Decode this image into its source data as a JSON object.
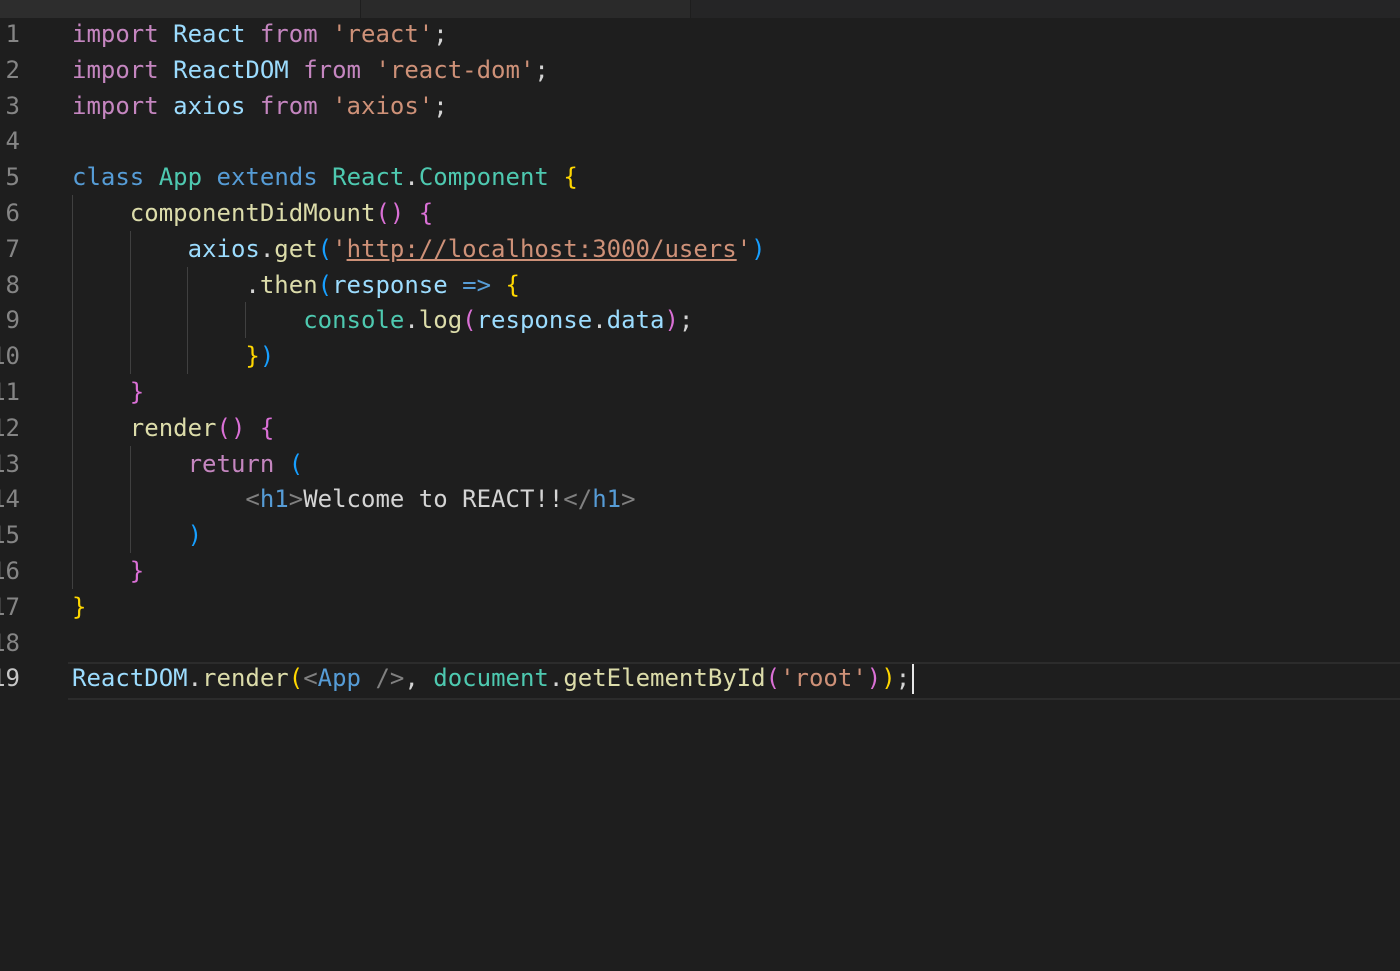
{
  "editor": {
    "active_line": 19,
    "lines": [
      {
        "number": "1",
        "tokens": [
          {
            "t": "import",
            "c": "kw"
          },
          {
            "t": " ",
            "c": "p"
          },
          {
            "t": "React",
            "c": "var"
          },
          {
            "t": " ",
            "c": "p"
          },
          {
            "t": "from",
            "c": "kw"
          },
          {
            "t": " ",
            "c": "p"
          },
          {
            "t": "'react'",
            "c": "str"
          },
          {
            "t": ";",
            "c": "p"
          }
        ]
      },
      {
        "number": "2",
        "tokens": [
          {
            "t": "import",
            "c": "kw"
          },
          {
            "t": " ",
            "c": "p"
          },
          {
            "t": "ReactDOM",
            "c": "var"
          },
          {
            "t": " ",
            "c": "p"
          },
          {
            "t": "from",
            "c": "kw"
          },
          {
            "t": " ",
            "c": "p"
          },
          {
            "t": "'react-dom'",
            "c": "str"
          },
          {
            "t": ";",
            "c": "p"
          }
        ]
      },
      {
        "number": "3",
        "tokens": [
          {
            "t": "import",
            "c": "kw"
          },
          {
            "t": " ",
            "c": "p"
          },
          {
            "t": "axios",
            "c": "var"
          },
          {
            "t": " ",
            "c": "p"
          },
          {
            "t": "from",
            "c": "kw"
          },
          {
            "t": " ",
            "c": "p"
          },
          {
            "t": "'axios'",
            "c": "str"
          },
          {
            "t": ";",
            "c": "p"
          }
        ]
      },
      {
        "number": "4",
        "tokens": []
      },
      {
        "number": "5",
        "tokens": [
          {
            "t": "class",
            "c": "kb"
          },
          {
            "t": " ",
            "c": "p"
          },
          {
            "t": "App",
            "c": "cls"
          },
          {
            "t": " ",
            "c": "p"
          },
          {
            "t": "extends",
            "c": "kb"
          },
          {
            "t": " ",
            "c": "p"
          },
          {
            "t": "React",
            "c": "cls"
          },
          {
            "t": ".",
            "c": "p"
          },
          {
            "t": "Component",
            "c": "cls"
          },
          {
            "t": " ",
            "c": "p"
          },
          {
            "t": "{",
            "c": "b1"
          }
        ]
      },
      {
        "number": "6",
        "tokens": [
          {
            "t": "    ",
            "c": "p"
          },
          {
            "t": "componentDidMount",
            "c": "fn"
          },
          {
            "t": "()",
            "c": "b2"
          },
          {
            "t": " ",
            "c": "p"
          },
          {
            "t": "{",
            "c": "b2"
          }
        ]
      },
      {
        "number": "7",
        "tokens": [
          {
            "t": "        ",
            "c": "p"
          },
          {
            "t": "axios",
            "c": "var"
          },
          {
            "t": ".",
            "c": "p"
          },
          {
            "t": "get",
            "c": "fn"
          },
          {
            "t": "(",
            "c": "b3"
          },
          {
            "t": "'",
            "c": "str"
          },
          {
            "t": "http://localhost:3000/users",
            "c": "url"
          },
          {
            "t": "'",
            "c": "str"
          },
          {
            "t": ")",
            "c": "b3"
          }
        ]
      },
      {
        "number": "8",
        "tokens": [
          {
            "t": "            ",
            "c": "p"
          },
          {
            "t": ".",
            "c": "p"
          },
          {
            "t": "then",
            "c": "fn"
          },
          {
            "t": "(",
            "c": "b3"
          },
          {
            "t": "response",
            "c": "var"
          },
          {
            "t": " ",
            "c": "p"
          },
          {
            "t": "=>",
            "c": "kb"
          },
          {
            "t": " ",
            "c": "p"
          },
          {
            "t": "{",
            "c": "b1"
          }
        ]
      },
      {
        "number": "9",
        "tokens": [
          {
            "t": "                ",
            "c": "p"
          },
          {
            "t": "console",
            "c": "cls"
          },
          {
            "t": ".",
            "c": "p"
          },
          {
            "t": "log",
            "c": "fn"
          },
          {
            "t": "(",
            "c": "b2"
          },
          {
            "t": "response",
            "c": "var"
          },
          {
            "t": ".",
            "c": "p"
          },
          {
            "t": "data",
            "c": "var"
          },
          {
            "t": ")",
            "c": "b2"
          },
          {
            "t": ";",
            "c": "p"
          }
        ]
      },
      {
        "number": "10",
        "tokens": [
          {
            "t": "            ",
            "c": "p"
          },
          {
            "t": "}",
            "c": "b1"
          },
          {
            "t": ")",
            "c": "b3"
          }
        ]
      },
      {
        "number": "11",
        "tokens": [
          {
            "t": "    ",
            "c": "p"
          },
          {
            "t": "}",
            "c": "b2"
          }
        ]
      },
      {
        "number": "12",
        "tokens": [
          {
            "t": "    ",
            "c": "p"
          },
          {
            "t": "render",
            "c": "fn"
          },
          {
            "t": "()",
            "c": "b2"
          },
          {
            "t": " ",
            "c": "p"
          },
          {
            "t": "{",
            "c": "b2"
          }
        ]
      },
      {
        "number": "13",
        "tokens": [
          {
            "t": "        ",
            "c": "p"
          },
          {
            "t": "return",
            "c": "kw"
          },
          {
            "t": " ",
            "c": "p"
          },
          {
            "t": "(",
            "c": "b3"
          }
        ]
      },
      {
        "number": "14",
        "tokens": [
          {
            "t": "            ",
            "c": "p"
          },
          {
            "t": "<",
            "c": "tagb"
          },
          {
            "t": "h1",
            "c": "tag"
          },
          {
            "t": ">",
            "c": "tagb"
          },
          {
            "t": "Welcome to REACT!!",
            "c": "txt"
          },
          {
            "t": "</",
            "c": "tagb"
          },
          {
            "t": "h1",
            "c": "tag"
          },
          {
            "t": ">",
            "c": "tagb"
          }
        ]
      },
      {
        "number": "15",
        "tokens": [
          {
            "t": "        ",
            "c": "p"
          },
          {
            "t": ")",
            "c": "b3"
          }
        ]
      },
      {
        "number": "16",
        "tokens": [
          {
            "t": "    ",
            "c": "p"
          },
          {
            "t": "}",
            "c": "b2"
          }
        ]
      },
      {
        "number": "17",
        "tokens": [
          {
            "t": "}",
            "c": "b1"
          }
        ]
      },
      {
        "number": "18",
        "tokens": []
      },
      {
        "number": "19",
        "tokens": [
          {
            "t": "ReactDOM",
            "c": "var"
          },
          {
            "t": ".",
            "c": "p"
          },
          {
            "t": "render",
            "c": "fn"
          },
          {
            "t": "(",
            "c": "b1"
          },
          {
            "t": "<",
            "c": "tagb"
          },
          {
            "t": "App",
            "c": "tag"
          },
          {
            "t": " ",
            "c": "p"
          },
          {
            "t": "/>",
            "c": "tagb"
          },
          {
            "t": ",",
            "c": "p"
          },
          {
            "t": " ",
            "c": "p"
          },
          {
            "t": "document",
            "c": "cls"
          },
          {
            "t": ".",
            "c": "p"
          },
          {
            "t": "getElementById",
            "c": "fn"
          },
          {
            "t": "(",
            "c": "b2"
          },
          {
            "t": "'root'",
            "c": "str"
          },
          {
            "t": ")",
            "c": "b2"
          },
          {
            "t": ")",
            "c": "b1"
          },
          {
            "t": ";",
            "c": "p"
          }
        ]
      }
    ]
  }
}
